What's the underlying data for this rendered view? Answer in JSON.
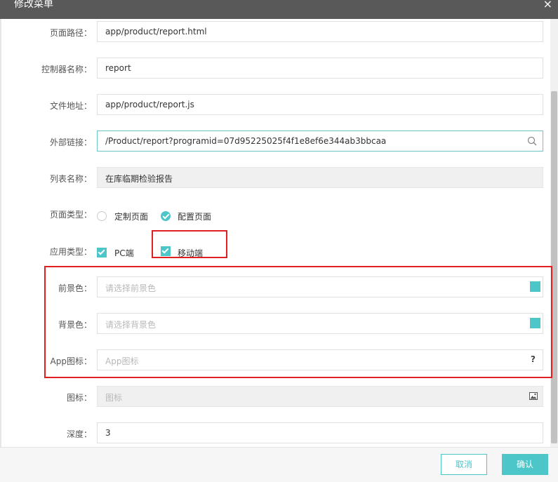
{
  "dialog": {
    "title": "修改菜单",
    "close_icon": "×"
  },
  "form": {
    "page_path": {
      "label": "页面路径：",
      "value": "app/product/report.html"
    },
    "controller_name": {
      "label": "控制器名称：",
      "value": "report"
    },
    "file_address": {
      "label": "文件地址：",
      "value": "app/product/report.js"
    },
    "external_link": {
      "label": "外部链接：",
      "value": "/Product/report?programid=07d95225025f4f1e8ef6e344ab3bbcaa"
    },
    "list_name": {
      "label": "列表名称：",
      "value": "在库临期检验报告"
    },
    "page_type": {
      "label": "页面类型：",
      "options": [
        "定制页面",
        "配置页面"
      ],
      "selected": "配置页面"
    },
    "app_type": {
      "label": "应用类型：",
      "options": [
        "PC端",
        "移动端"
      ],
      "checked": [
        "PC端",
        "移动端"
      ]
    },
    "foreground_color": {
      "label": "前景色：",
      "placeholder": "请选择前景色",
      "swatch_color": "#4dc6c9"
    },
    "background_color": {
      "label": "背景色：",
      "placeholder": "请选择背景色",
      "swatch_color": "#4dc6c9"
    },
    "app_icon": {
      "label": "App图标：",
      "placeholder": "App图标",
      "help": "?"
    },
    "icon": {
      "label": "图标：",
      "placeholder": "图标"
    },
    "depth": {
      "label": "深度：",
      "value": "3"
    }
  },
  "footer": {
    "cancel_label": "取消",
    "confirm_label": "确认"
  },
  "colors": {
    "accent": "#4dc6c9",
    "highlight_border": "#e02020",
    "titlebar": "#595959"
  }
}
